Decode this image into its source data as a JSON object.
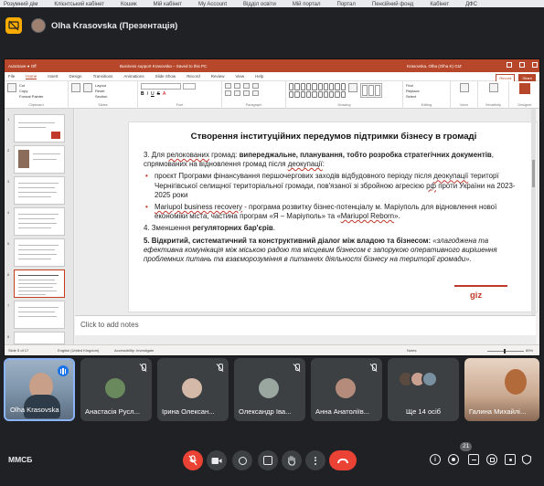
{
  "browser_bookmarks": [
    "Розумний дім",
    "Клієнтський кабінет",
    "Кошик",
    "Мій кабінет",
    "My Account",
    "Відділ освіти",
    "Мій портал",
    "Портал",
    "Пенсійний фонд",
    "Кабінет",
    "ДФС"
  ],
  "meet": {
    "presenter": "Olha Krasovska (Презентація)",
    "meeting_code": "ММСБ",
    "participants_count": "21",
    "colors": {
      "background": "#202124",
      "tile": "#3c4043",
      "hangup": "#ea4335",
      "speaking": "#1a73e8"
    }
  },
  "powerpoint": {
    "title_left": "AutoSave ● Off",
    "title_center": "Business support Krasovska – Saved to this PC",
    "title_user": "Krasovska, Olha (Olha K) GIZ",
    "tabs": [
      "File",
      "Home",
      "Insert",
      "Design",
      "Transitions",
      "Animations",
      "Slide Show",
      "Record",
      "Review",
      "View",
      "Help"
    ],
    "active_tab": "Home",
    "share_buttons": [
      "Record",
      "Share"
    ],
    "ribbon": {
      "clipboard": {
        "label": "Clipboard",
        "paste": "Paste",
        "cut": "Cut",
        "copy": "Copy",
        "format": "Format Painter"
      },
      "slides": {
        "label": "Slides",
        "new_slide": "New Slide",
        "reuse": "Reuse Slides",
        "layout": "Layout",
        "reset": "Reset",
        "section": "Section"
      },
      "font": {
        "label": "Font"
      },
      "paragraph": {
        "label": "Paragraph"
      },
      "drawing": {
        "label": "Drawing",
        "arrange": "Arrange",
        "quick_styles": "Quick Styles"
      },
      "editing": {
        "label": "Editing",
        "find": "Find",
        "replace": "Replace",
        "select": "Select"
      },
      "voice": {
        "label": "Voice",
        "dictate": "Dictate"
      },
      "sensitivity": {
        "label": "Sensitivity"
      },
      "designer": {
        "label": "Designer"
      }
    },
    "thumbnail_numbers": [
      "1",
      "2",
      "3",
      "4",
      "5",
      "6",
      "7",
      "8"
    ],
    "selected_slide": 5,
    "slide": {
      "title": "Створення інституційних передумов підтримки бізнесу в громаді",
      "p3_prefix": "3. Для ",
      "p3_link": "релокованих",
      "p3_mid": " громад: ",
      "p3_bold": "випереджальне, планування, тобто розробка стратегічних документів",
      "p3_tail": ", спрямованих на відновлення громад після ",
      "p3_link2": "деокупації",
      "p3_end": ":",
      "b1_a": "проєкт Програми фінансування першочергових заходів відбудовного періоду після ",
      "b1_link": "деокупації",
      "b1_b": " територ",
      "b1_c": "ї Чернігівської селищної територіальної громади, пов'язаної зі збройною агресією ",
      "b1_link2": "рф",
      "b1_d": " проти України на 2023-2025 роки",
      "b2_link": "Mariupol business recovery",
      "b2_a": " - програма розвитку бізнес-потенціалу м. Маріуполь для відновлення нової економіки міста, частина програм «Я – Маріуполь» та «",
      "b2_link2": "Mariupol Reborn",
      "b2_b": "».",
      "p4_a": "4. Зменшення ",
      "p4_bold": "регуляторних бар'єрів",
      "p4_b": ".",
      "p5_bold": "5. Відкритий, систематичний та конструктивний діалог між владою та бізнесом:",
      "p5_italic": " «злагоджена та ефективна комунікація між міською радою та місцевим бізнесом є запорукою оперативного вирішення проблемних питань та взаєморозуміння в питаннях діяльності бізнесу на території громади».",
      "logo": "giz"
    },
    "notes_placeholder": "Click to add notes",
    "status": {
      "slide_of": "Slide 5 of 17",
      "language": "English (United Kingdom)",
      "accessibility": "Accessibility: Investigate",
      "notes": "Notes",
      "zoom": "89%"
    }
  },
  "participants": [
    {
      "name": "Olha Krasovska",
      "speaking": true
    },
    {
      "name": "Анастасія Русл...",
      "muted": true
    },
    {
      "name": "Ірина Олексан...",
      "muted": true
    },
    {
      "name": "Олександр Іва...",
      "muted": true
    },
    {
      "name": "Анна Анатоліїв...",
      "muted": true
    },
    {
      "name": "Ще 14 осіб"
    },
    {
      "name": "Галина Михайлі...",
      "muted": true
    }
  ]
}
